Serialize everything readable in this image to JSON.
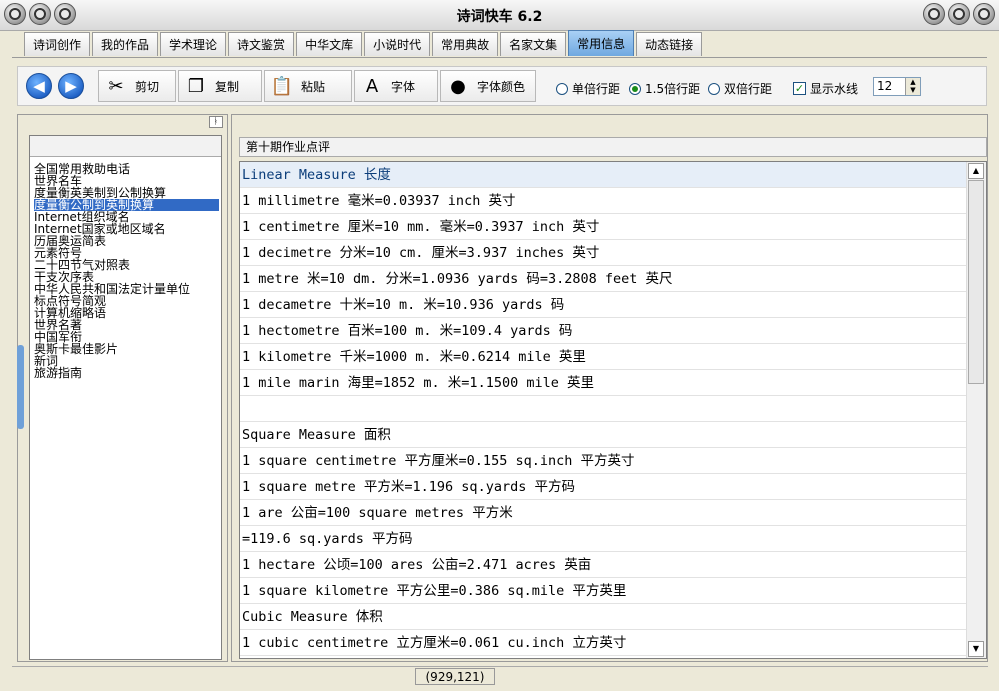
{
  "app": {
    "title": "诗词快车 6.2"
  },
  "tabs": [
    {
      "label": "诗词创作"
    },
    {
      "label": "我的作品"
    },
    {
      "label": "学术理论"
    },
    {
      "label": "诗文鉴赏"
    },
    {
      "label": "中华文库"
    },
    {
      "label": "小说时代"
    },
    {
      "label": "常用典故"
    },
    {
      "label": "名家文集"
    },
    {
      "label": "常用信息",
      "active": true
    },
    {
      "label": "动态链接"
    }
  ],
  "toolbar": {
    "cut_label": "剪切",
    "copy_label": "复制",
    "paste_label": "粘贴",
    "font_label": "字体",
    "font_color_label": "字体颜色",
    "single_spacing": "单倍行距",
    "one_half_spacing": "1.5倍行距",
    "double_spacing": "双倍行距",
    "show_watermark": "显示水线",
    "font_size": "12",
    "selected_spacing": "1.5倍行距",
    "watermark_checked": true
  },
  "sidebar": {
    "items": [
      {
        "label": "全国常用救助电话"
      },
      {
        "label": "世界名车"
      },
      {
        "label": "度量衡英美制到公制换算"
      },
      {
        "label": "度量衡公制到英制换算",
        "selected": true
      },
      {
        "label": "Internet组织域名"
      },
      {
        "label": "Internet国家或地区域名"
      },
      {
        "label": "历届奥运简表"
      },
      {
        "label": "元素符号"
      },
      {
        "label": "二十四节气对照表"
      },
      {
        "label": "干支次序表"
      },
      {
        "label": "中华人民共和国法定计量单位"
      },
      {
        "label": "标点符号简观"
      },
      {
        "label": "计算机缩略语"
      },
      {
        "label": "世界名著"
      },
      {
        "label": "中国军衔"
      },
      {
        "label": "奥斯卡最佳影片"
      },
      {
        "label": "新词"
      },
      {
        "label": "旅游指南"
      }
    ]
  },
  "document": {
    "header": "第十期作业点评",
    "lines": [
      "Linear Measure 长度",
      "1 millimetre 毫米=0.03937 inch 英寸",
      "1 centimetre 厘米=10 mm. 毫米=0.3937 inch 英寸",
      "1 decimetre 分米=10 cm. 厘米=3.937 inches 英寸",
      "1 metre 米=10 dm. 分米=1.0936 yards 码=3.2808 feet 英尺",
      "1 decametre 十米=10 m. 米=10.936 yards 码",
      "1 hectometre 百米=100 m. 米=109.4 yards 码",
      "1 kilometre 千米=1000 m. 米=0.6214 mile 英里",
      "1 mile marin 海里=1852 m. 米=1.1500 mile 英里",
      "",
      "Square Measure 面积",
      "1 square centimetre 平方厘米=0.155 sq.inch 平方英寸",
      "1 square metre 平方米=1.196 sq.yards 平方码",
      "1 are 公亩=100 square metres 平方米",
      "  =119.6 sq.yards 平方码",
      "1 hectare 公顷=100 ares 公亩=2.471 acres 英亩",
      "1 square kilometre 平方公里=0.386 sq.mile 平方英里",
      "Cubic Measure 体积",
      "1 cubic centimetre 立方厘米=0.061 cu.inch 立方英寸"
    ]
  },
  "statusbar": {
    "coords": "(929,121)"
  },
  "colors": {
    "accent_tab": "#6fa8e0",
    "selection": "#316ac5",
    "nav_button": "#1d5fc4"
  },
  "icons": [
    "close-icon",
    "arrow-left-icon",
    "arrow-right-icon",
    "scissors-icon",
    "copy-icon",
    "paste-icon",
    "font-icon",
    "font-color-icon",
    "pin-icon",
    "scroll-up-icon",
    "scroll-down-icon"
  ]
}
